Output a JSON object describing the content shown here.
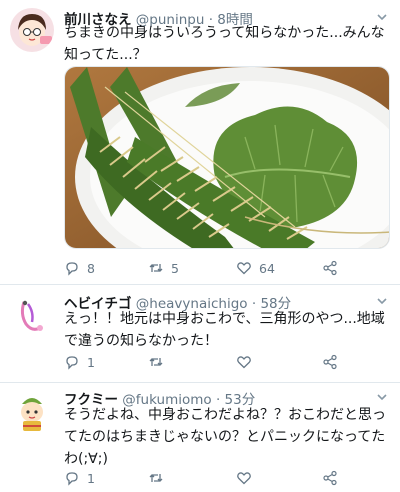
{
  "tweets": [
    {
      "name": "前川さなえ",
      "handle": "@puninpu",
      "time": "· 8時間",
      "text": "ちまきの中身はういろうって知らなかった...みんな知ってた...？",
      "replies": "8",
      "retweets": "5",
      "likes": "64"
    },
    {
      "name": "ヘビイチゴ",
      "handle": "@heavynaichigo",
      "time": "· 58分",
      "text": "えっ！！地元は中身おこわで、三角形のやつ...地域で違うの知らなかった！",
      "replies": "1",
      "retweets": "",
      "likes": ""
    },
    {
      "name": "フクミー",
      "handle": "@fukumiomo",
      "time": "· 53分",
      "text": "そうだよね、中身おこわだよね？？おこわだと思ってたのはちまきじゃないの？とパニックになってたわ(;∀;)",
      "replies": "1",
      "retweets": "",
      "likes": ""
    }
  ],
  "colors": {
    "text": "#14171a",
    "secondary": "#657786",
    "divider": "#e1e8ed"
  }
}
